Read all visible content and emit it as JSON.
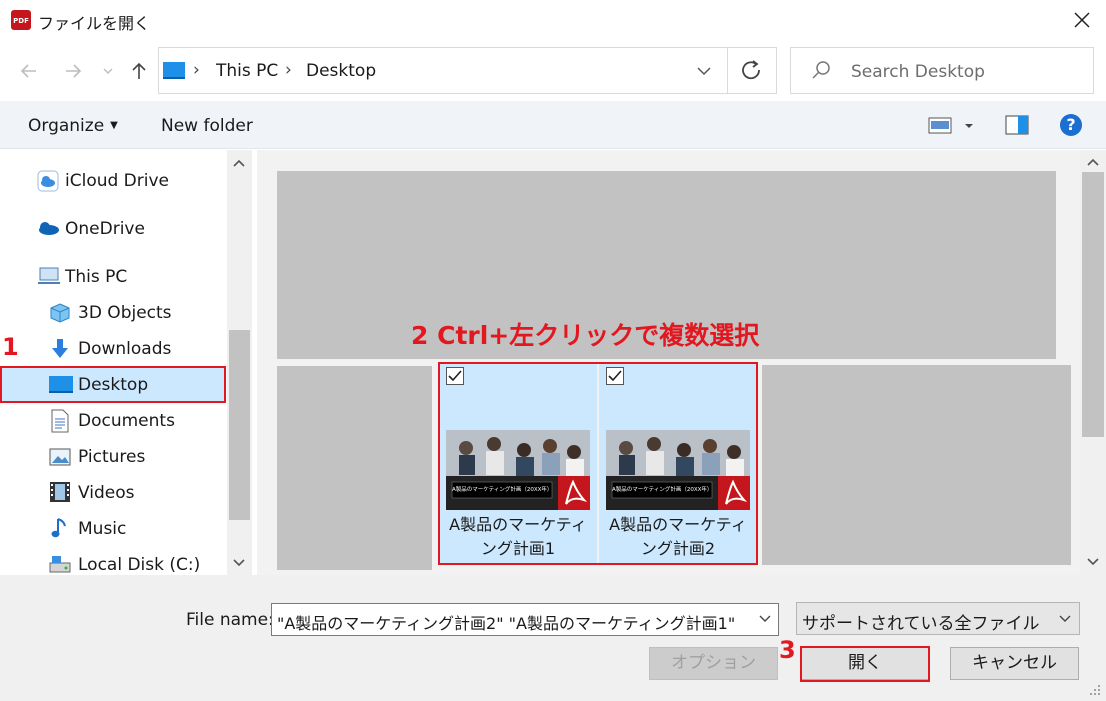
{
  "window": {
    "title": "ファイルを開く"
  },
  "address": {
    "path": [
      "This PC",
      "Desktop"
    ]
  },
  "search": {
    "placeholder": "Search Desktop"
  },
  "toolbar": {
    "organize_label": "Organize",
    "new_folder_label": "New folder",
    "help_label": "?"
  },
  "sidebar": {
    "items": [
      {
        "label": "iCloud Drive",
        "icon": "icloud-icon"
      },
      {
        "label": "OneDrive",
        "icon": "onedrive-icon"
      },
      {
        "label": "This PC",
        "icon": "pc-icon"
      },
      {
        "label": "3D Objects",
        "icon": "cube-icon"
      },
      {
        "label": "Downloads",
        "icon": "download-arrow-icon"
      },
      {
        "label": "Desktop",
        "icon": "desktop-icon",
        "selected": true
      },
      {
        "label": "Documents",
        "icon": "document-icon"
      },
      {
        "label": "Pictures",
        "icon": "picture-icon"
      },
      {
        "label": "Videos",
        "icon": "film-icon"
      },
      {
        "label": "Music",
        "icon": "music-note-icon"
      },
      {
        "label": "Local Disk (C:)",
        "icon": "disk-icon"
      }
    ]
  },
  "files": [
    {
      "name": "A製品のマーケティング計画1",
      "line1": "A製品のマーケティ",
      "line2": "ング計画1",
      "checked": true,
      "thumb_caption": "A製品のマーケティング計画（20XX年）"
    },
    {
      "name": "A製品のマーケティング計画2",
      "line1": "A製品のマーケティ",
      "line2": "ング計画2",
      "checked": true,
      "thumb_caption": "A製品のマーケティング計画（20XX年）"
    }
  ],
  "annotations": {
    "step1": "1",
    "step2": "2 Ctrl+左クリックで複数選択",
    "step3": "3",
    "color": "#e3171f"
  },
  "footer": {
    "file_name_label": "File name:",
    "file_name_value": "\"A製品のマーケティング計画2\" \"A製品のマーケティング計画1\"",
    "file_type_value": "サポートされている全ファイル",
    "options_label": "オプション",
    "open_label": "開く",
    "cancel_label": "キャンセル"
  },
  "colors": {
    "accent": "#0078d7",
    "selection": "#cce8ff",
    "annotation": "#e3171f",
    "pdf_red": "#c4161c"
  }
}
